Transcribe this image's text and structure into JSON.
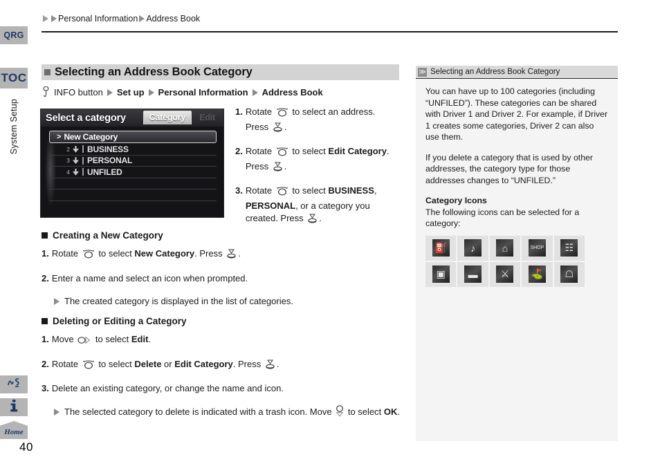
{
  "page": {
    "number": "40",
    "breadcrumb": [
      "Personal Information",
      "Address Book"
    ]
  },
  "rail": {
    "qrg_label": "QRG",
    "toc_label": "TOC",
    "section_label": "System Setup",
    "home_label": "Home",
    "voice_icon": "voice-command-icon",
    "info_icon": "information-icon"
  },
  "section": {
    "title": "Selecting an Address Book Category",
    "nav_path": {
      "button": "INFO button",
      "items": [
        "Set up",
        "Personal Information",
        "Address Book"
      ]
    }
  },
  "screenshot": {
    "title": "Select a category",
    "tab_active": "Category",
    "tab_inactive": "Edit",
    "rows": [
      {
        "num": "",
        "label": "New Category",
        "selected": true
      },
      {
        "num": "2",
        "label": "BUSINESS",
        "selected": false
      },
      {
        "num": "3",
        "label": "PERSONAL",
        "selected": false
      },
      {
        "num": "4",
        "label": "UNFILED",
        "selected": false
      }
    ]
  },
  "steps_main": [
    {
      "n": "1.",
      "html": "Rotate <KNOB> to select an address. Press <PRESS>."
    },
    {
      "n": "2.",
      "html": "Rotate <KNOB> to select <b>Edit Category</b>. Press <PRESS>."
    },
    {
      "n": "3.",
      "html": "Rotate <KNOB> to select <b>BUSINESS</b>, <b>PERSONAL</b>, or a category you created. Press <PRESS>."
    }
  ],
  "creating": {
    "title": "Creating a New Category",
    "steps": [
      {
        "n": "1.",
        "html": "Rotate <KNOB> to select <b>New Category</b>. Press <PRESS>."
      },
      {
        "n": "2.",
        "html": "Enter a name and select an icon when prompted."
      }
    ],
    "note": "The created category is displayed in the list of categories."
  },
  "deleting": {
    "title": "Deleting or Editing a Category",
    "steps": [
      {
        "n": "1.",
        "html": "Move <MOVE> to select <b>Edit</b>."
      },
      {
        "n": "2.",
        "html": "Rotate <KNOB> to select <b>Delete</b> or <b>Edit Category</b>. Press <PRESS>."
      },
      {
        "n": "3.",
        "html": "Delete an existing category, or change the name and icon."
      }
    ],
    "note": "The selected category to delete is indicated with a trash icon. Move <DOWN> to select <b>OK</b>."
  },
  "panel": {
    "header": "Selecting an Address Book Category",
    "marker": "≫",
    "paragraphs": [
      "You can have up to 100 categories (including “UNFILED”). These categories can be shared with Driver 1 and Driver 2. For example, if Driver 1 creates some categories, Driver 2 can also use them.",
      "If you delete a category that is used by other addresses, the category type for those addresses changes to “UNFILED.”"
    ],
    "icons_heading": "Category Icons",
    "icons_intro": "The following icons can be selected for a category:",
    "icons": [
      {
        "name": "fuel-pump-icon",
        "glyph": "⛽"
      },
      {
        "name": "music-note-icon",
        "glyph": "♪"
      },
      {
        "name": "home-letter-a-icon",
        "glyph": "⌂"
      },
      {
        "name": "shop-storefront-icon",
        "glyph": "SHOP"
      },
      {
        "name": "office-building-icon",
        "glyph": "☷"
      },
      {
        "name": "camera-photo-icon",
        "glyph": "▣"
      },
      {
        "name": "car-vehicle-icon",
        "glyph": "▬"
      },
      {
        "name": "sports-racket-icon",
        "glyph": "⚔"
      },
      {
        "name": "golf-flag-icon",
        "glyph": "⛳"
      },
      {
        "name": "school-building-icon",
        "glyph": "☖"
      }
    ]
  },
  "colors": {
    "rail_tab_bg": "#b4b4b4",
    "rail_tab_text": "#1f3864",
    "section_bar_bg": "#d3d3d3",
    "panel_bg": "#f4f4f4",
    "panel_head_bg": "#d9d9d9"
  }
}
